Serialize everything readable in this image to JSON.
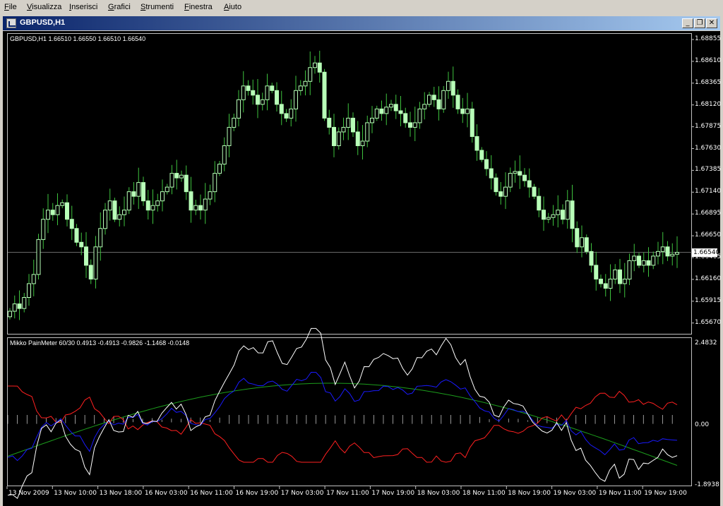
{
  "menu": [
    "File",
    "Visualizza",
    "Inserisci",
    "Grafici",
    "Strumenti",
    "Finestra",
    "Aiuto"
  ],
  "window": {
    "title": "GBPUSD,H1",
    "buttons": {
      "minimize": "_",
      "restore": "❐",
      "close": "✕"
    }
  },
  "chart": {
    "header": "GBPUSD,H1  1.66510 1.66550 1.66510 1.66540",
    "current_price": "1.66540",
    "price_ticks": [
      "1.68855",
      "1.68610",
      "1.68365",
      "1.68120",
      "1.67875",
      "1.67630",
      "1.67385",
      "1.67140",
      "1.66895",
      "1.66650",
      "1.66405",
      "1.66160",
      "1.65915",
      "1.65670"
    ],
    "time_ticks": [
      "13 Nov 2009",
      "13 Nov 10:00",
      "13 Nov 18:00",
      "16 Nov 03:00",
      "16 Nov 11:00",
      "16 Nov 19:00",
      "17 Nov 03:00",
      "17 Nov 11:00",
      "17 Nov 19:00",
      "18 Nov 03:00",
      "18 Nov 11:00",
      "18 Nov 19:00",
      "19 Nov 03:00",
      "19 Nov 11:00",
      "19 Nov 19:00"
    ],
    "candle_color": "#b8ffb8",
    "wick_color": "#3ec23e"
  },
  "indicator": {
    "header": "Mikko PainMeter 60/30 0.4913 -0.4913 -0.9826 -1.1468 -0.0148",
    "ticks": [
      "2.4832",
      "0.00",
      "-1.8938"
    ],
    "colors": {
      "white": "#ffffff",
      "blue": "#1a1aff",
      "red": "#ff2020",
      "green": "#1c9c1c"
    }
  },
  "chart_data": {
    "type": "candlestick",
    "title": "GBPUSD,H1",
    "ylim": [
      1.6567,
      1.69
    ],
    "closes": [
      1.659,
      1.6598,
      1.6593,
      1.6605,
      1.662,
      1.663,
      1.6668,
      1.669,
      1.67,
      1.6695,
      1.6705,
      1.6708,
      1.669,
      1.668,
      1.6665,
      1.666,
      1.664,
      1.6625,
      1.666,
      1.668,
      1.67,
      1.671,
      1.669,
      1.6695,
      1.67,
      1.672,
      1.6715,
      1.673,
      1.671,
      1.67,
      1.6705,
      1.671,
      1.672,
      1.6725,
      1.674,
      1.6735,
      1.6738,
      1.672,
      1.67,
      1.6705,
      1.67,
      1.6712,
      1.672,
      1.674,
      1.675,
      1.677,
      1.679,
      1.68,
      1.682,
      1.6835,
      1.683,
      1.6825,
      1.6815,
      1.682,
      1.6835,
      1.683,
      1.6815,
      1.6805,
      1.68,
      1.681,
      1.683,
      1.6835,
      1.684,
      1.6855,
      1.686,
      1.685,
      1.68,
      1.679,
      1.677,
      1.6785,
      1.679,
      1.68,
      1.6785,
      1.677,
      1.6775,
      1.6795,
      1.68,
      1.681,
      1.6805,
      1.6812,
      1.6815,
      1.6808,
      1.6805,
      1.6795,
      1.679,
      1.6795,
      1.681,
      1.6815,
      1.6825,
      1.682,
      1.681,
      1.683,
      1.684,
      1.6825,
      1.681,
      1.6805,
      1.681,
      1.678,
      1.6765,
      1.6755,
      1.6745,
      1.6735,
      1.672,
      1.6715,
      1.6725,
      1.674,
      1.6742,
      1.6738,
      1.6732,
      1.6725,
      1.6715,
      1.67,
      1.669,
      1.6692,
      1.6695,
      1.67,
      1.669,
      1.671,
      1.668,
      1.666,
      1.667,
      1.6655,
      1.664,
      1.6625,
      1.662,
      1.6615,
      1.6625,
      1.6635,
      1.662,
      1.6625,
      1.6645,
      1.665,
      1.664,
      1.6645,
      1.664,
      1.665,
      1.6655,
      1.666,
      1.665,
      1.6652,
      1.6654
    ],
    "indicator_series": [
      {
        "name": "0.4913",
        "color": "white"
      },
      {
        "name": "-0.4913",
        "color": "red"
      },
      {
        "name": "-0.9826",
        "color": "blue"
      },
      {
        "name": "-1.1468",
        "color": "green"
      },
      {
        "name": "-0.0148",
        "color": "histogram"
      }
    ]
  }
}
